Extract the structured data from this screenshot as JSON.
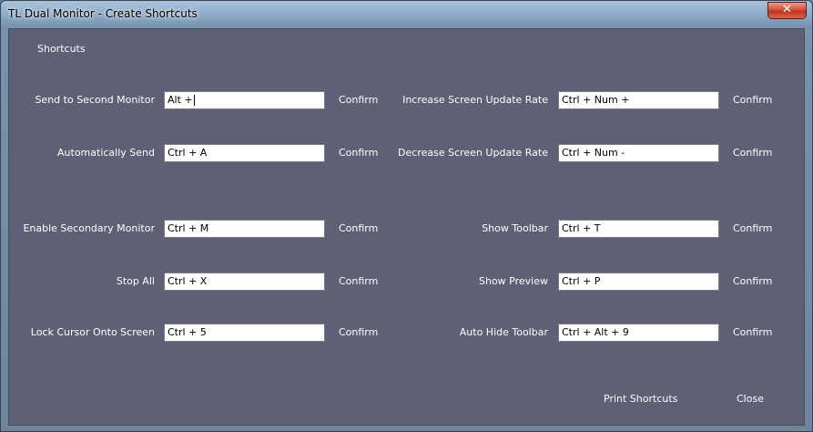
{
  "window": {
    "title": "TL Dual Monitor - Create Shortcuts",
    "close_glyph": "✕"
  },
  "section_title": "Shortcuts",
  "confirm_label": "Confirm",
  "left": [
    {
      "label": "Send to Second Monitor",
      "value": "Alt +"
    },
    {
      "label": "Automatically Send",
      "value": "Ctrl + A"
    },
    {
      "label": "Enable Secondary Monitor",
      "value": "Ctrl + M"
    },
    {
      "label": "Stop All",
      "value": "Ctrl + X"
    },
    {
      "label": "Lock Cursor Onto Screen",
      "value": "Ctrl + 5"
    }
  ],
  "right": [
    {
      "label": "Increase Screen Update Rate",
      "value": "Ctrl + Num +"
    },
    {
      "label": "Decrease Screen Update Rate",
      "value": "Ctrl + Num -"
    },
    {
      "label": "Show Toolbar",
      "value": "Ctrl + T"
    },
    {
      "label": "Show Preview",
      "value": "Ctrl + P"
    },
    {
      "label": "Auto Hide Toolbar",
      "value": "Ctrl + Alt + 9"
    }
  ],
  "footer": {
    "print_label": "Print Shortcuts",
    "close_label": "Close"
  }
}
